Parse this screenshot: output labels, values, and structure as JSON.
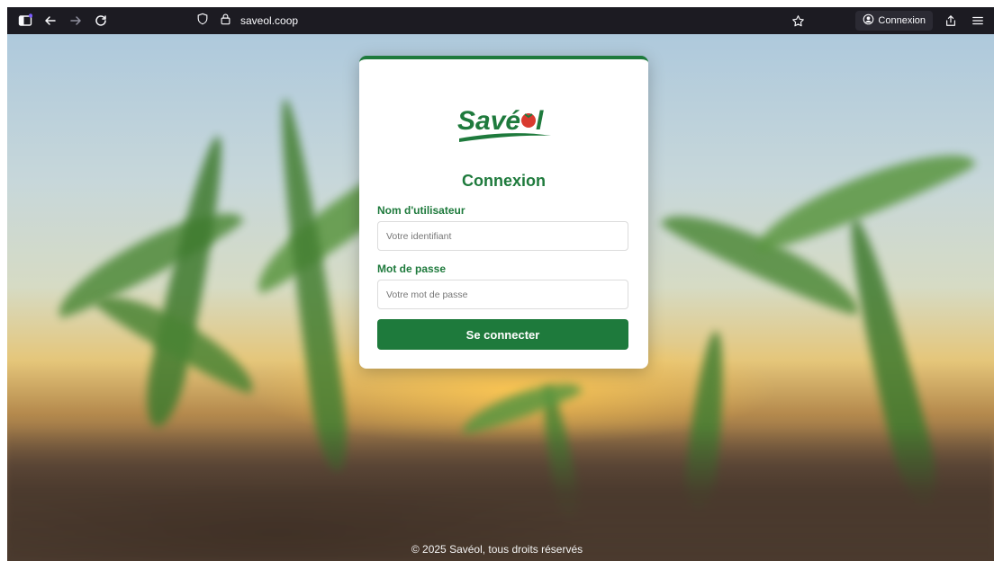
{
  "browser": {
    "url": "saveol.coop",
    "account_label": "Connexion"
  },
  "brand": {
    "logo_text": "Savéol",
    "primary_color": "#1e7a3c",
    "accent_color": "#d93a2f"
  },
  "login": {
    "title": "Connexion",
    "username_label": "Nom d'utilisateur",
    "username_placeholder": "Votre identifiant",
    "password_label": "Mot de passe",
    "password_placeholder": "Votre mot de passe",
    "submit_label": "Se connecter"
  },
  "footer": {
    "text": "© 2025 Savéol, tous droits réservés"
  }
}
